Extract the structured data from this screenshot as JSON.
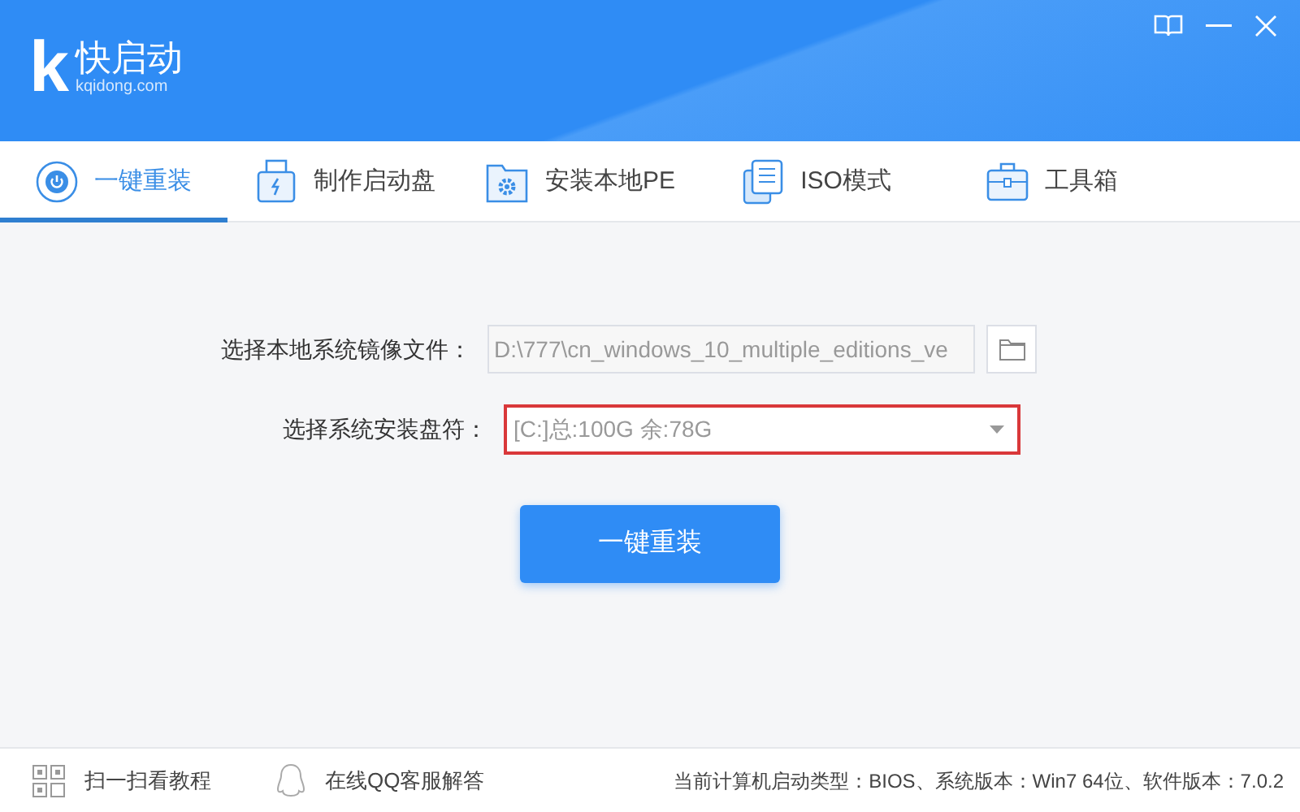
{
  "app": {
    "logo_letter": "k",
    "name": "快启动",
    "domain": "kqidong.com"
  },
  "tabs": [
    {
      "label": "一键重装",
      "selected": true,
      "kind": "power"
    },
    {
      "label": "制作启动盘",
      "selected": false,
      "kind": "usb"
    },
    {
      "label": "安装本地PE",
      "selected": false,
      "kind": "gear"
    },
    {
      "label": "ISO模式",
      "selected": false,
      "kind": "doc"
    },
    {
      "label": "工具箱",
      "selected": false,
      "kind": "toolbox"
    }
  ],
  "form": {
    "image_label": "选择本地系统镜像文件：",
    "image_path": "D:\\777\\cn_windows_10_multiple_editions_ve",
    "drive_label": "选择系统安装盘符：",
    "drive_value": "[C:]总:100G 余:78G",
    "drive_highlighted": true,
    "install_button": "一键重装"
  },
  "footer": {
    "links": [
      {
        "label": "扫一扫看教程",
        "kind": "qr"
      },
      {
        "label": "在线QQ客服解答",
        "kind": "qq"
      }
    ],
    "status": "当前计算机启动类型：BIOS、系统版本：Win7 64位、软件版本：7.0.2"
  }
}
